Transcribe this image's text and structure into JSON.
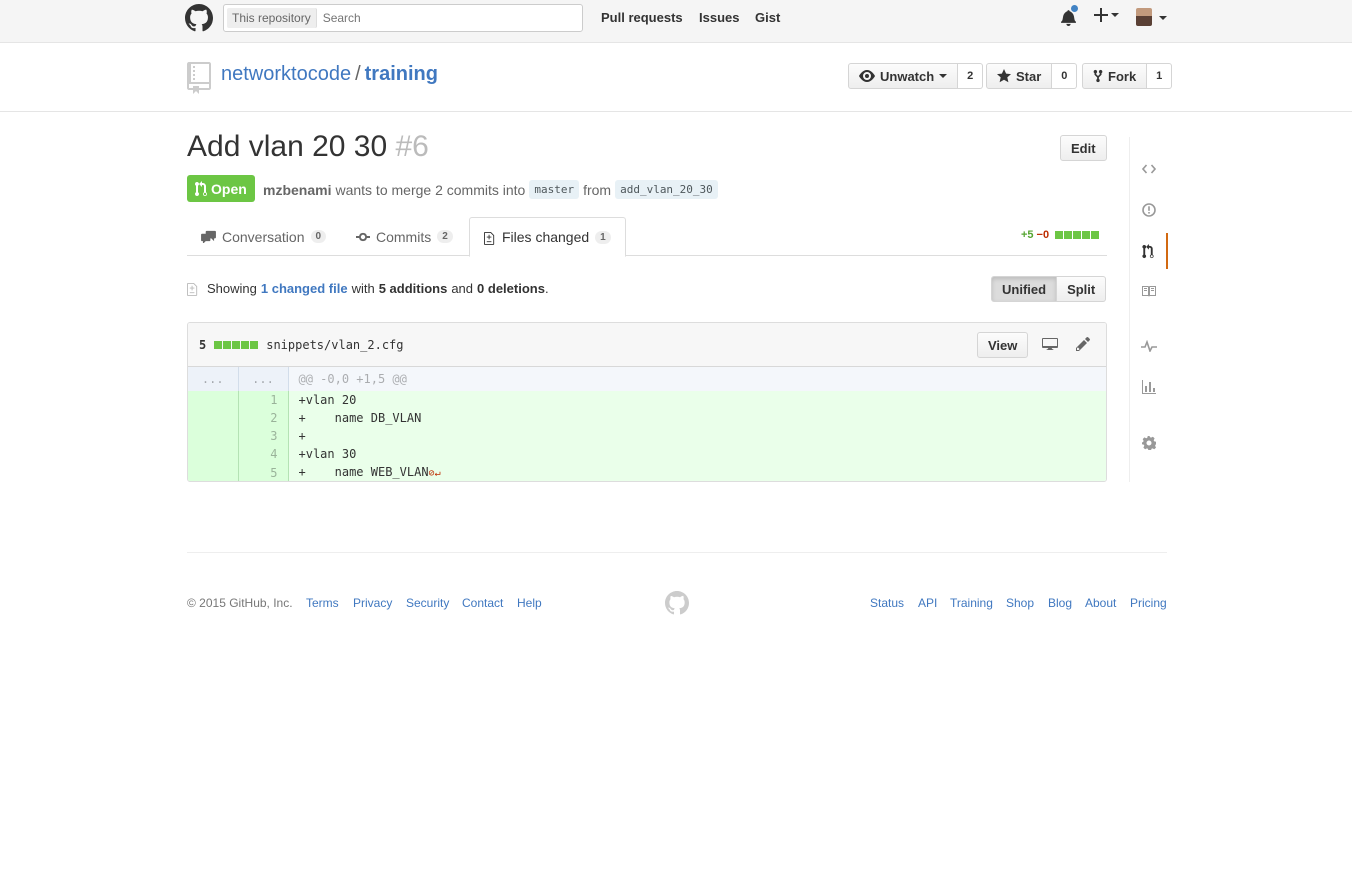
{
  "header": {
    "search_scope": "This repository",
    "search_placeholder": "Search",
    "nav": [
      "Pull requests",
      "Issues",
      "Gist"
    ],
    "icons": [
      "github-mark-icon",
      "bell-icon",
      "plus-icon",
      "avatar"
    ]
  },
  "repo": {
    "owner": "networktocode",
    "separator": "/",
    "name": "training",
    "watch_label": "Unwatch",
    "watch_count": "2",
    "star_label": "Star",
    "star_count": "0",
    "fork_label": "Fork",
    "fork_count": "1"
  },
  "pr": {
    "title": "Add vlan 20 30",
    "number": "#6",
    "edit_label": "Edit",
    "state": "Open",
    "author": "mzbenami",
    "meta_text": "wants to merge 2 commits into",
    "base_branch": "master",
    "from_text": "from",
    "head_branch": "add_vlan_20_30"
  },
  "tabs": [
    {
      "label": "Conversation",
      "count": "0"
    },
    {
      "label": "Commits",
      "count": "2"
    },
    {
      "label": "Files changed",
      "count": "1"
    }
  ],
  "diffstat": {
    "additions": "+5",
    "deletions": "−0"
  },
  "toc": {
    "showing": "Showing",
    "changed_files": "1 changed file",
    "with": "with",
    "additions": "5 additions",
    "and": "and",
    "deletions": "0 deletions",
    "period": "."
  },
  "view_toggle": {
    "unified": "Unified",
    "split": "Split"
  },
  "file": {
    "changes": "5",
    "path": "snippets/vlan_2.cfg",
    "view_label": "View",
    "hunk_ellipsis": "...",
    "hunk_header": "@@ -0,0 +1,5 @@",
    "lines": [
      {
        "num": "1",
        "code": "+vlan 20"
      },
      {
        "num": "2",
        "code": "+    name DB_VLAN"
      },
      {
        "num": "3",
        "code": "+"
      },
      {
        "num": "4",
        "code": "+vlan 30"
      },
      {
        "num": "5",
        "code": "+    name WEB_VLAN"
      }
    ],
    "no_newline_marker": "⊘↵"
  },
  "sidenav": [
    "code-icon",
    "issue-icon",
    "pull-request-icon",
    "wiki-icon",
    "pulse-icon",
    "graph-icon",
    "settings-icon"
  ],
  "footer": {
    "copyright": "© 2015 GitHub, Inc.",
    "left_links": [
      "Terms",
      "Privacy",
      "Security",
      "Contact",
      "Help"
    ],
    "right_links": [
      "Status",
      "API",
      "Training",
      "Shop",
      "Blog",
      "About",
      "Pricing"
    ]
  },
  "colors": {
    "accent": "#4078c0",
    "open_green": "#6cc644",
    "addition_bg": "#eaffea",
    "selected_nav": "#d26911"
  }
}
